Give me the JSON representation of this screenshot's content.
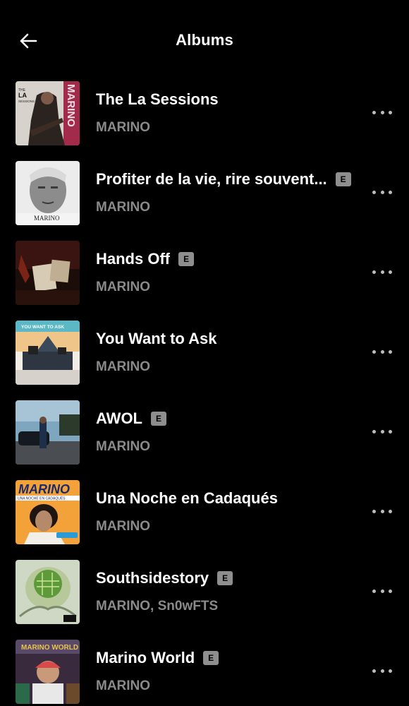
{
  "header": {
    "title": "Albums"
  },
  "albums": [
    {
      "name": "The La Sessions",
      "artist": "MARINO",
      "explicit": false
    },
    {
      "name": "Profiter de la vie, rire souvent...",
      "artist": "MARINO",
      "explicit": true
    },
    {
      "name": "Hands Off",
      "artist": "MARINO",
      "explicit": true
    },
    {
      "name": "You Want to Ask",
      "artist": "MARINO",
      "explicit": false
    },
    {
      "name": "AWOL",
      "artist": "MARINO",
      "explicit": true
    },
    {
      "name": "Una Noche en Cadaqués",
      "artist": "MARINO",
      "explicit": false
    },
    {
      "name": "Southsidestory",
      "artist": "MARINO, Sn0wFTS",
      "explicit": true
    },
    {
      "name": "Marino World",
      "artist": "MARINO",
      "explicit": true
    }
  ],
  "explicit_label": "E",
  "cover_text": {
    "la_sessions_small": "THE",
    "la_sessions_big": "LA",
    "la_sessions_sub": "SESSIONS",
    "la_sessions_side": "MARINO",
    "profiter_logo": "MARINO",
    "you_want_title": "YOU WANT TO ASK",
    "una_noche_logo": "MARINO",
    "una_noche_sub": "UNA NOCHE EN CADAQUÉS",
    "marino_world_logo": "MARINO WORLD"
  }
}
